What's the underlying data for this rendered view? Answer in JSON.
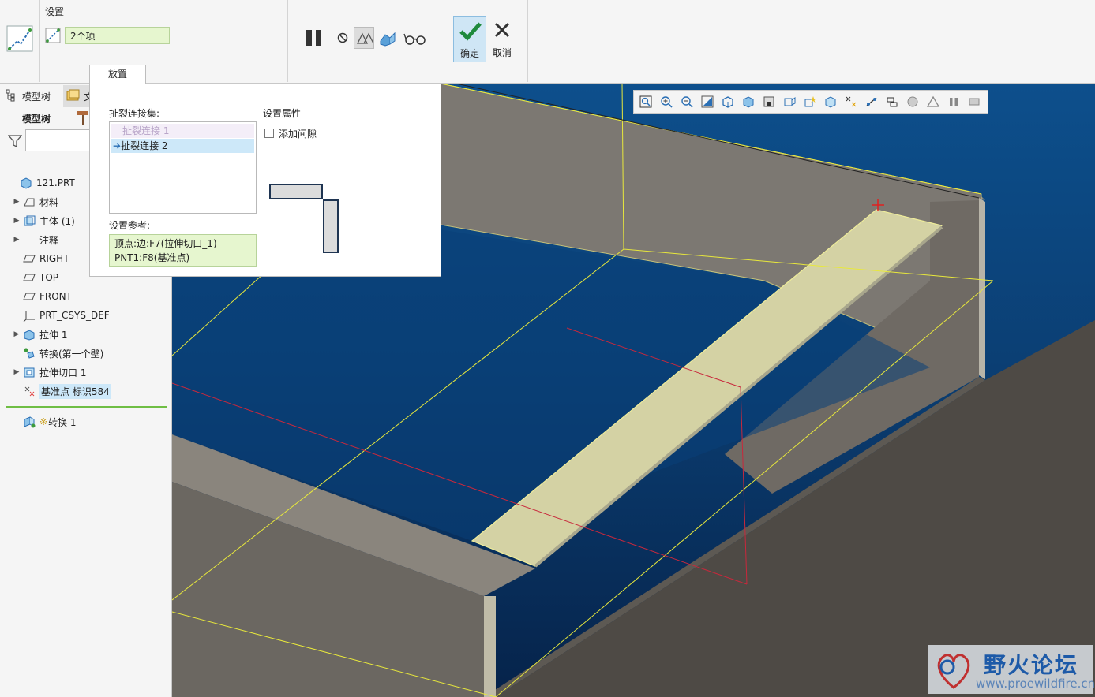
{
  "ribbon": {
    "settings_label": "设置",
    "items_value": "2个项",
    "placement_tab": "放置",
    "ok_label": "确定",
    "cancel_label": "取消"
  },
  "left_panel": {
    "tab_model_tree": "模型树",
    "tab_other": "文",
    "tree_header": "模型树",
    "tree": [
      {
        "label": "121.PRT",
        "expandable": false,
        "icon": "part-icon"
      },
      {
        "label": "材料",
        "expandable": true,
        "icon": "material-icon"
      },
      {
        "label": "主体 (1)",
        "expandable": true,
        "icon": "body-icon"
      },
      {
        "label": "注释",
        "expandable": true,
        "icon": "annotation-icon"
      },
      {
        "label": "RIGHT",
        "expandable": false,
        "icon": "plane-icon"
      },
      {
        "label": "TOP",
        "expandable": false,
        "icon": "plane-icon"
      },
      {
        "label": "FRONT",
        "expandable": false,
        "icon": "plane-icon"
      },
      {
        "label": "PRT_CSYS_DEF",
        "expandable": false,
        "icon": "csys-icon"
      },
      {
        "label": "拉伸 1",
        "expandable": true,
        "icon": "extrude-icon"
      },
      {
        "label": "转换(第一个壁)",
        "expandable": false,
        "icon": "convert-icon"
      },
      {
        "label": "拉伸切口 1",
        "expandable": true,
        "icon": "extrude-cut-icon"
      },
      {
        "label": "基准点 标识584",
        "expandable": false,
        "icon": "datum-point-icon"
      }
    ],
    "insert_item": {
      "prefix": "※",
      "label": "转换 1"
    }
  },
  "placement_panel": {
    "tear_set_label": "扯裂连接集:",
    "tear_items": [
      "扯裂连接 1",
      "扯裂连接 2"
    ],
    "ref_label": "设置参考:",
    "refs": [
      "顶点:边:F7(拉伸切口_1)",
      "PNT1:F8(基准点)"
    ],
    "props_label": "设置属性",
    "gap_label": "添加间隙"
  },
  "watermark": {
    "title": "野火论坛",
    "url": "www.proewildfire.cn"
  },
  "colors": {
    "accent": "#cde8f9",
    "field_green": "#e6f6cf",
    "tree_divider": "#6fbe44",
    "viewport_top": "#0d4f8c",
    "viewport_bottom": "#06234a",
    "model_face": "#7e7a74",
    "highlight_face": "#d4d2a4",
    "datum_yellow": "#e8e83c",
    "datum_red": "#c8283c"
  }
}
